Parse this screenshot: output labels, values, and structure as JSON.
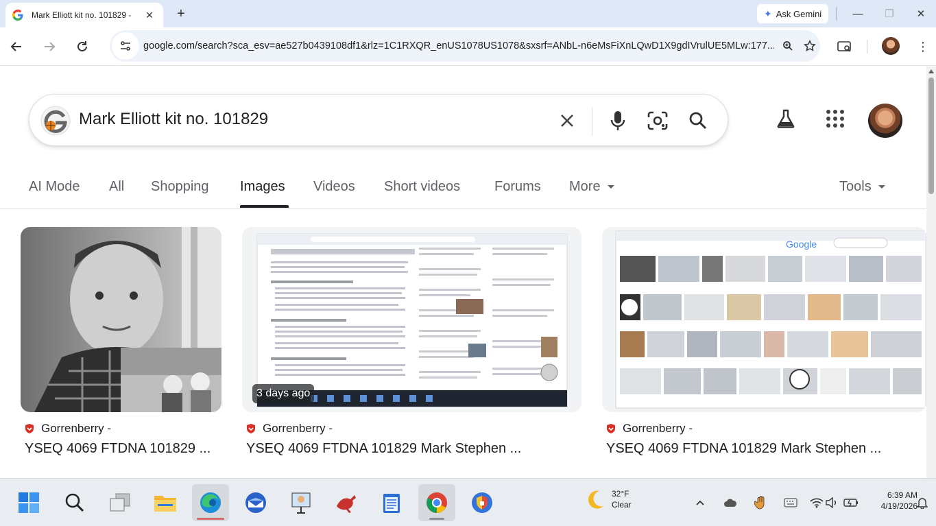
{
  "browser": {
    "tab_title": "Mark Elliott kit no. 101829 -",
    "new_tab_symbol": "+",
    "gemini_label": "Ask Gemini",
    "url": "google.com/search?sca_esv=ae527b0439108df1&rlz=1C1RXQR_enUS1078US1078&sxsrf=ANbL-n6eMsFiXnLQwD1X9gdIVrulUE5MLw:177...",
    "window_controls": [
      "minimize",
      "restore",
      "close"
    ]
  },
  "search": {
    "query": "Mark Elliott kit no. 101829"
  },
  "tabs": [
    {
      "label": "AI Mode"
    },
    {
      "label": "All"
    },
    {
      "label": "Shopping"
    },
    {
      "label": "Images"
    },
    {
      "label": "Videos"
    },
    {
      "label": "Short videos"
    },
    {
      "label": "Forums"
    },
    {
      "label": "More"
    }
  ],
  "tools_label": "Tools",
  "results": [
    {
      "source": "Gorrenberry -",
      "title": "YSEQ 4069 FTDNA 101829 ..."
    },
    {
      "source": "Gorrenberry -",
      "title": "YSEQ 4069 FTDNA 101829 Mark Stephen ...",
      "badge": "3 days ago"
    },
    {
      "source": "Gorrenberry -",
      "title": "YSEQ 4069 FTDNA 101829 Mark Stephen ..."
    }
  ],
  "taskbar": {
    "weather_temp": "32°F",
    "weather_cond": "Clear",
    "time": "6:39 AM",
    "date": "4/19/2026"
  },
  "colors": {
    "tabstrip": "#dfe8f7",
    "omnibox": "#eef2f9",
    "taskbar": "#e9edf2",
    "source_shield": "#d93025"
  }
}
